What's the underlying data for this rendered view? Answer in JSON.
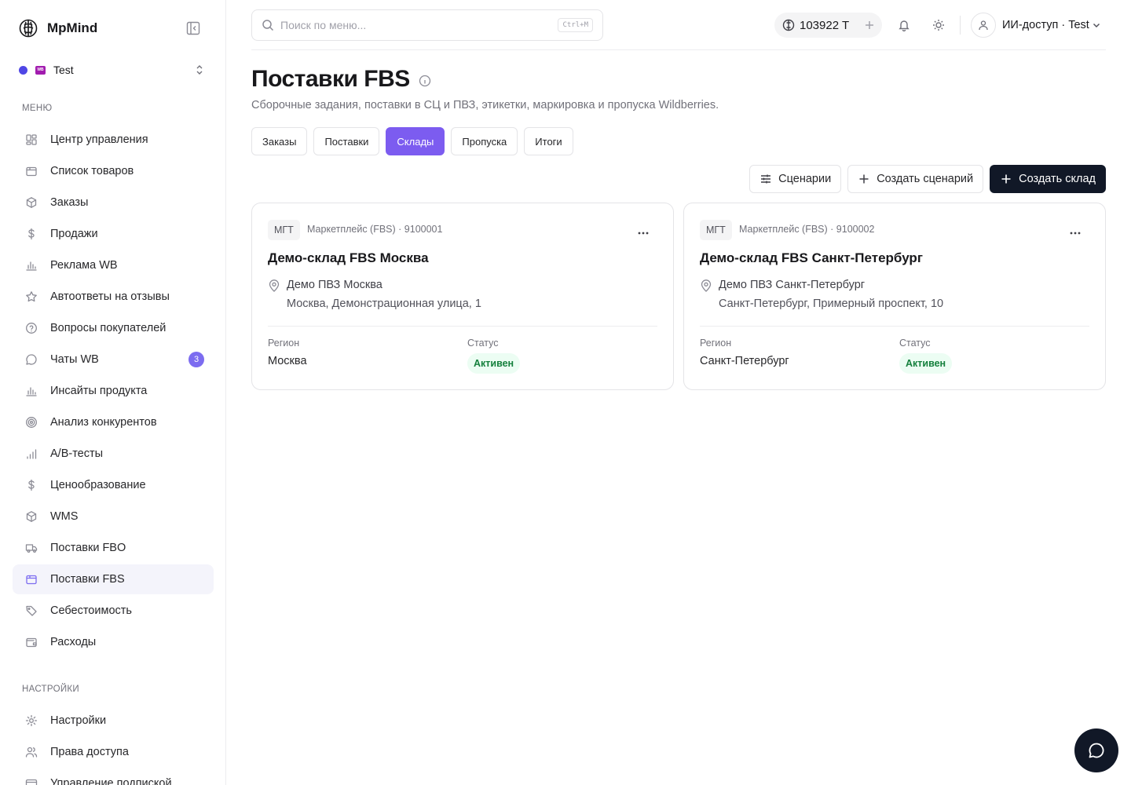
{
  "app": {
    "name": "MpMind"
  },
  "workspace": {
    "name": "Test",
    "badge": "WB"
  },
  "sidebar": {
    "menu_label": "МЕНЮ",
    "settings_label": "НАСТРОЙКИ",
    "items": [
      {
        "label": "Центр управления",
        "icon": "dashboard-icon"
      },
      {
        "label": "Список товаров",
        "icon": "box-icon"
      },
      {
        "label": "Заказы",
        "icon": "package-icon"
      },
      {
        "label": "Продажи",
        "icon": "dollar-icon"
      },
      {
        "label": "Реклама WB",
        "icon": "bar-chart-icon"
      },
      {
        "label": "Автоответы на отзывы",
        "icon": "star-icon"
      },
      {
        "label": "Вопросы покупателей",
        "icon": "help-circle-icon"
      },
      {
        "label": "Чаты WB",
        "icon": "chat-icon",
        "count": "3"
      },
      {
        "label": "Инсайты продукта",
        "icon": "bar-chart-icon"
      },
      {
        "label": "Анализ конкурентов",
        "icon": "target-icon"
      },
      {
        "label": "A/B-тесты",
        "icon": "signal-icon"
      },
      {
        "label": "Ценообразование",
        "icon": "dollar-icon"
      },
      {
        "label": "WMS",
        "icon": "package-icon"
      },
      {
        "label": "Поставки FBO",
        "icon": "truck-icon"
      },
      {
        "label": "Поставки FBS",
        "icon": "box-icon",
        "active": true
      },
      {
        "label": "Себестоимость",
        "icon": "tag-icon"
      },
      {
        "label": "Расходы",
        "icon": "wallet-icon"
      }
    ],
    "settings_items": [
      {
        "label": "Настройки",
        "icon": "gear-icon"
      },
      {
        "label": "Права доступа",
        "icon": "users-icon"
      },
      {
        "label": "Управление подпиской",
        "icon": "card-icon"
      }
    ]
  },
  "header": {
    "search_placeholder": "Поиск по меню...",
    "search_shortcut": "Ctrl+M",
    "balance": "103922 T",
    "user_label": "ИИ-доступ · Test"
  },
  "page": {
    "title": "Поставки FBS",
    "subtitle": "Сборочные задания, поставки в СЦ и ПВЗ, этикетки, маркировка и пропуска Wildberries.",
    "tabs": [
      {
        "label": "Заказы"
      },
      {
        "label": "Поставки"
      },
      {
        "label": "Склады",
        "active": true
      },
      {
        "label": "Пропуска"
      },
      {
        "label": "Итоги"
      }
    ],
    "actions": {
      "scenarios": "Сценарии",
      "create_scenario": "Создать сценарий",
      "create_warehouse": "Создать склад"
    },
    "region_label": "Регион",
    "status_label": "Статус",
    "warehouses": [
      {
        "tag": "МГТ",
        "meta": "Маркетплейс (FBS) · 9100001",
        "title": "Демо-склад FBS Москва",
        "pvz": "Демо ПВЗ Москва",
        "address": "Москва, Демонстрационная улица, 1",
        "region": "Москва",
        "status": "Активен"
      },
      {
        "tag": "МГТ",
        "meta": "Маркетплейс (FBS) · 9100002",
        "title": "Демо-склад FBS Санкт-Петербург",
        "pvz": "Демо ПВЗ Санкт-Петербург",
        "address": "Санкт-Петербург, Примерный проспект, 10",
        "region": "Санкт-Петербург",
        "status": "Активен"
      }
    ]
  },
  "colors": {
    "accent": "#7c5cf0",
    "primary_button": "#111827",
    "status_active_bg": "#ecfdf3",
    "status_active_text": "#15803d",
    "workspace_dot": "#4f46e5"
  }
}
